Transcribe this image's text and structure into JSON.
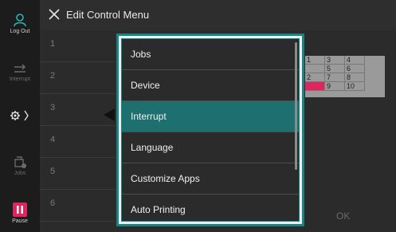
{
  "header": {
    "title": "Edit Control Menu"
  },
  "sidebar": {
    "logout_label": "Log Out",
    "interrupt_label": "Interrupt",
    "jobs_label": "Jobs",
    "pause_label": "Pause"
  },
  "positions": [
    "1",
    "2",
    "3",
    "4",
    "5",
    "6"
  ],
  "preview": {
    "rows": [
      [
        "1",
        "3",
        "4"
      ],
      [
        "",
        "5",
        "6"
      ],
      [
        "2",
        "7",
        "8"
      ],
      [
        "",
        "9",
        "10"
      ]
    ]
  },
  "menu": {
    "items": [
      "Jobs",
      "Device",
      "Interrupt",
      "Language",
      "Customize Apps",
      "Auto Printing"
    ],
    "selected": "Interrupt"
  },
  "footer": {
    "ok_label": "OK"
  },
  "colors": {
    "accent": "#178484",
    "selected": "#1e6f6f",
    "pause": "#e0245e"
  }
}
